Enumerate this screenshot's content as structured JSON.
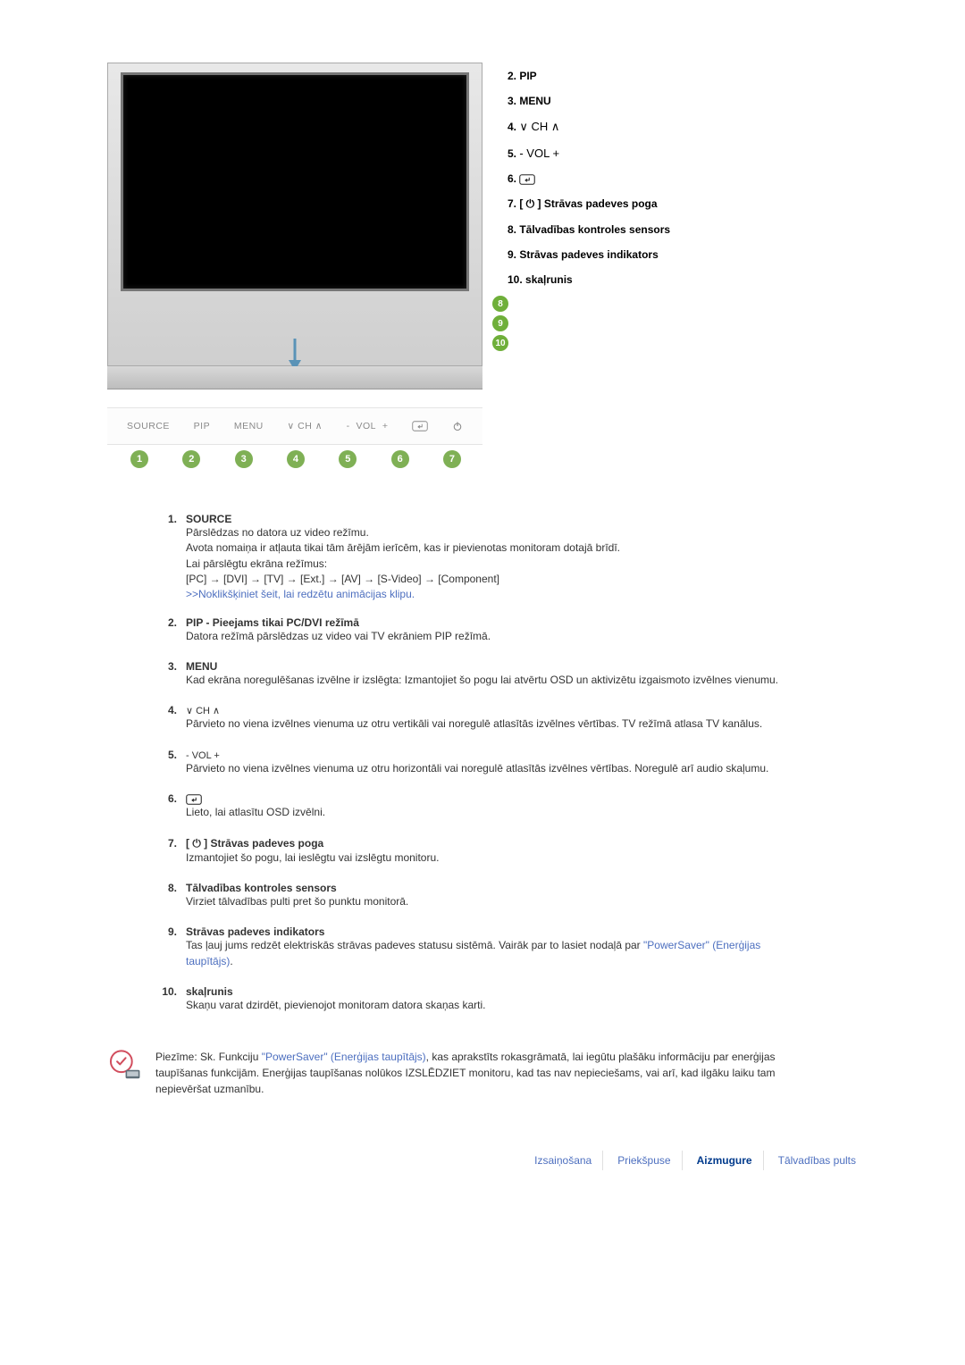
{
  "side": {
    "i2": "2. PIP",
    "i3": "3. MENU",
    "i4p": "4.",
    "i5p": "5.",
    "i6p": "6.",
    "i7": "7. [ ⏻ ] Strāvas padeves poga",
    "i8": "8. Tālvadības kontroles sensors",
    "i9": "9. Strāvas padeves indikators",
    "i10": "10. skaļrunis"
  },
  "btns": {
    "b1": "SOURCE",
    "b2": "PIP",
    "b3": "MENU",
    "b4_ch": "CH",
    "b5_vol": "VOL",
    "m1": "1",
    "m2": "2",
    "m3": "3",
    "m4": "4",
    "m5": "5",
    "m6": "6",
    "m7": "7",
    "mc8": "8",
    "mc9": "9",
    "mc10": "10"
  },
  "details": [
    {
      "num": "1.",
      "title": "SOURCE",
      "desc": "Pārslēdzas no datora uz video režīmu.\nAvota nomaiņa ir atļauta tikai tām ārējām ierīcēm, kas ir pievienotas monitoram dotajā brīdī.\nLai pārslēgtu ekrāna režīmus:\n[PC] → [DVI] → [TV] → [Ext.] → [AV] → [S-Video] → [Component]",
      "link": ">>Noklikšķiniet šeit, lai redzētu animācijas klipu."
    },
    {
      "num": "2.",
      "title": "PIP - Pieejams tikai PC/DVI režīmā",
      "desc": "Datora režīmā pārslēdzas uz video vai TV ekrāniem PIP režīmā."
    },
    {
      "num": "3.",
      "title": "MENU",
      "desc": "Kad ekrāna noregulēšanas izvēlne ir izslēgta: Izmantojiet šo pogu lai atvērtu OSD un aktivizētu izgaismoto izvēlnes vienumu."
    },
    {
      "num": "4.",
      "title_icon": "ch",
      "desc": "Pārvieto no viena izvēlnes vienuma uz otru vertikāli vai noregulē atlasītās izvēlnes vērtības. TV režīmā atlasa TV kanālus."
    },
    {
      "num": "5.",
      "title_icon": "vol",
      "desc": "Pārvieto no viena izvēlnes vienuma uz otru horizontāli vai noregulē atlasītās izvēlnes vērtības. Noregulē arī audio skaļumu."
    },
    {
      "num": "6.",
      "title_icon": "enter",
      "desc": "Lieto, lai atlasītu OSD izvēlni."
    },
    {
      "num": "7.",
      "title": "[ ⏻ ] Strāvas padeves poga",
      "desc": "Izmantojiet šo pogu, lai ieslēgtu vai izslēgtu monitoru."
    },
    {
      "num": "8.",
      "title": "Tālvadības kontroles sensors",
      "desc": "Virziet tālvadības pulti pret šo punktu monitorā."
    },
    {
      "num": "9.",
      "title": "Strāvas padeves indikators",
      "desc": "Tas ļauj jums redzēt elektriskās strāvas padeves statusu sistēmā. Vairāk par to lasiet nodaļā par ",
      "link_inline": "\"PowerSaver\" (Enerģijas taupītājs)",
      "desc_after": "."
    },
    {
      "num": "10.",
      "title": "skaļrunis",
      "desc": "Skaņu varat dzirdēt, pievienojot monitoram datora skaņas karti."
    }
  ],
  "note": {
    "prefix": "Piezīme: Sk. Funkciju ",
    "link": "\"PowerSaver\" (Enerģijas taupītājs)",
    "rest": ", kas aprakstīts rokasgrāmatā, lai iegūtu plašāku informāciju par enerģijas taupīšanas funkcijām. Enerģijas taupīšanas nolūkos IZSLĒDZIET monitoru, kad tas nav nepieciešams, vai arī, kad ilgāku laiku tam nepievēršat uzmanību."
  },
  "tabs": {
    "t1": "Izsaiņošana",
    "t2": "Priekšpuse",
    "t3": "Aizmugure",
    "t4": "Tālvadības pults"
  }
}
